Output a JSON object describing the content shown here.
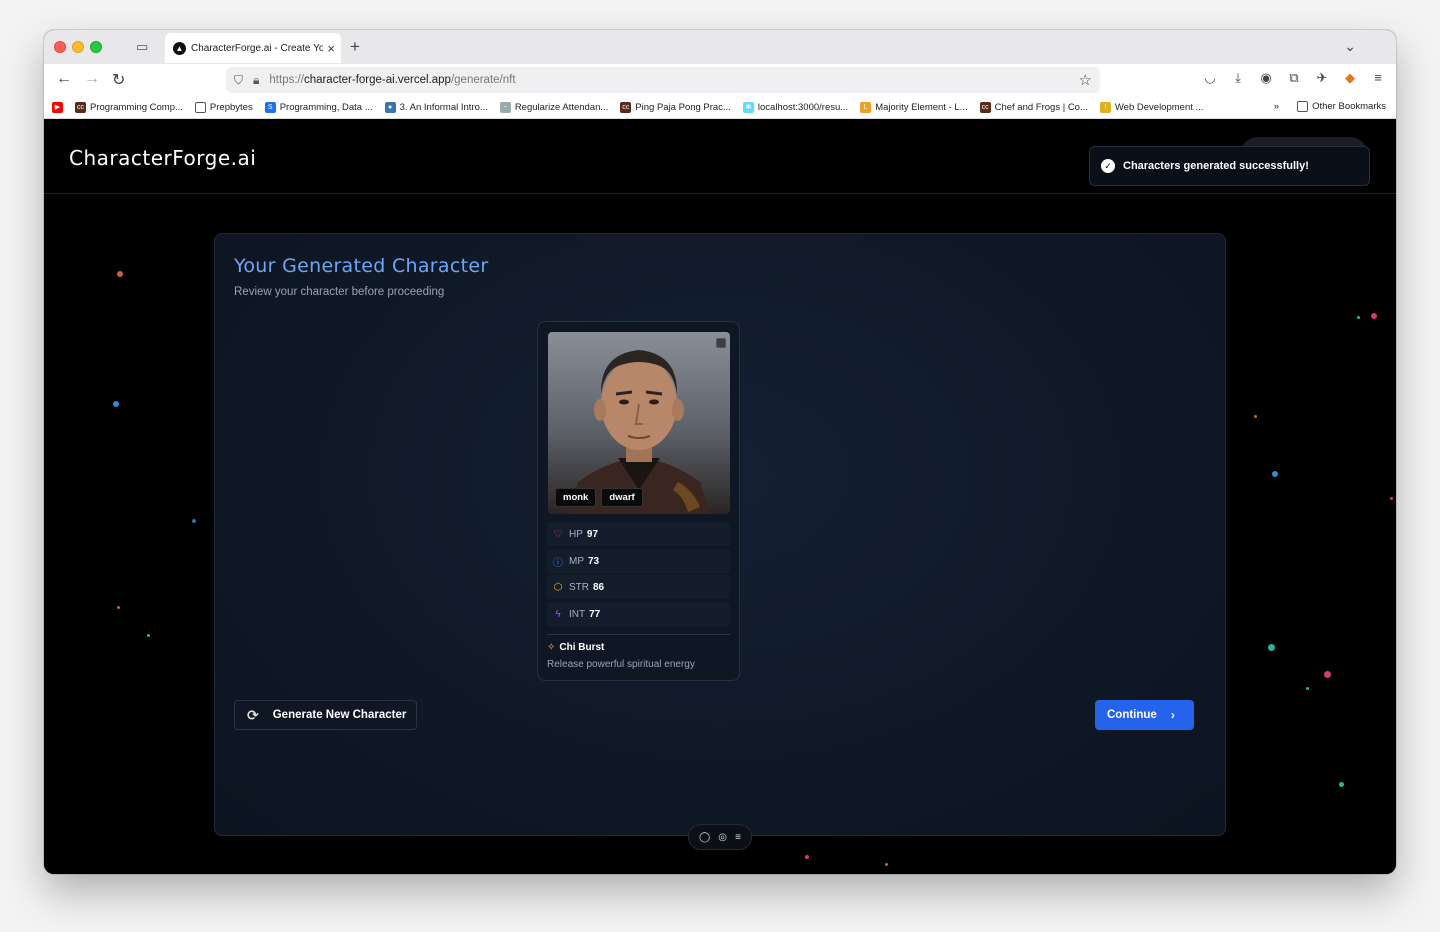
{
  "browser": {
    "tab": {
      "title": "CharacterForge.ai - Create Your",
      "favicon": "triangle-logo-icon"
    },
    "url": {
      "scheme": "https://",
      "host": "character-forge-ai.vercel.app",
      "path": "/generate/nft"
    },
    "bookmarks": [
      {
        "label": "Programming Comp...",
        "icon": "cc",
        "color": "#5a2a1a"
      },
      {
        "label": "Prepbytes",
        "icon": "folder",
        "color": "#888"
      },
      {
        "label": "Programming, Data ...",
        "icon": "s",
        "color": "#1a73e8"
      },
      {
        "label": "3. An Informal Intro...",
        "icon": "python",
        "color": "#3776ab"
      },
      {
        "label": "Regularize Attendan...",
        "icon": "bird",
        "color": "#888"
      },
      {
        "label": "Ping Paja Pong Prac...",
        "icon": "cc",
        "color": "#5a2a1a"
      },
      {
        "label": "localhost:3000/resu...",
        "icon": "react",
        "color": "#61dafb"
      },
      {
        "label": "Majority Element - L...",
        "icon": "leetcode",
        "color": "#f0a020"
      },
      {
        "label": "Chef and Frogs | Co...",
        "icon": "cc",
        "color": "#5a2a1a"
      },
      {
        "label": "Web Development ...",
        "icon": "bulb",
        "color": "#e0b020"
      }
    ],
    "other_bookmarks": "Other Bookmarks"
  },
  "site": {
    "logo": "CharacterForge.ai",
    "toast": "Characters generated successfully!"
  },
  "panel": {
    "title": "Your Generated Character",
    "subtitle": "Review your character before proceeding"
  },
  "character": {
    "tags": [
      "monk",
      "dwarf"
    ],
    "stats": [
      {
        "label": "HP",
        "value": "97",
        "icon": "heart-icon",
        "color": "#ef4444"
      },
      {
        "label": "MP",
        "value": "73",
        "icon": "info-icon",
        "color": "#3b82f6"
      },
      {
        "label": "STR",
        "value": "86",
        "icon": "shield-icon",
        "color": "#eab308"
      },
      {
        "label": "INT",
        "value": "77",
        "icon": "zap-icon",
        "color": "#a855f7"
      }
    ],
    "ability": {
      "name": "Chi Burst",
      "description": "Release powerful spiritual energy"
    }
  },
  "actions": {
    "generate": "Generate New Character",
    "continue": "Continue"
  }
}
